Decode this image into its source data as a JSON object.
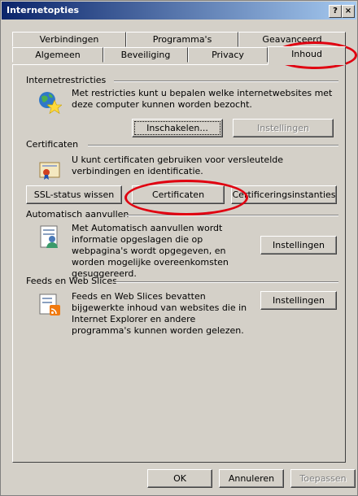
{
  "window": {
    "title": "Internetopties",
    "help_label": "?",
    "close_label": "×"
  },
  "tabs": {
    "row_back": [
      "Verbindingen",
      "Programma's",
      "Geavanceerd"
    ],
    "row_front": [
      "Algemeen",
      "Beveiliging",
      "Privacy",
      "Inhoud"
    ],
    "selected": "Inhoud"
  },
  "internet_restrictions": {
    "heading": "Internetrestricties",
    "description": "Met restricties kunt u bepalen welke internetwebsites met deze computer kunnen worden bezocht.",
    "enable_label": "Inschakelen...",
    "settings_label": "Instellingen",
    "icon": "globe-star-icon"
  },
  "certificates": {
    "heading": "Certificaten",
    "description": "U kunt certificaten gebruiken voor versleutelde verbindingen en identificatie.",
    "ssl_label": "SSL-status wissen",
    "certificates_label": "Certificaten",
    "authorities_label": "Certificeringsinstanties",
    "icon": "certificate-icon"
  },
  "autocomplete": {
    "heading": "Automatisch aanvullen",
    "description": "Met Automatisch aanvullen wordt informatie opgeslagen die op webpagina's wordt opgegeven, en worden mogelijke overeenkomsten gesuggereerd.",
    "settings_label": "Instellingen",
    "icon": "autocomplete-icon"
  },
  "feeds": {
    "heading": "Feeds en Web Slices",
    "description": "Feeds en Web Slices bevatten bijgewerkte inhoud van websites die in Internet Explorer en andere programma's kunnen worden gelezen.",
    "settings_label": "Instellingen",
    "icon": "feed-icon"
  },
  "footer": {
    "ok_label": "OK",
    "cancel_label": "Annuleren",
    "apply_label": "Toepassen"
  },
  "annotation_color": "#e00010"
}
